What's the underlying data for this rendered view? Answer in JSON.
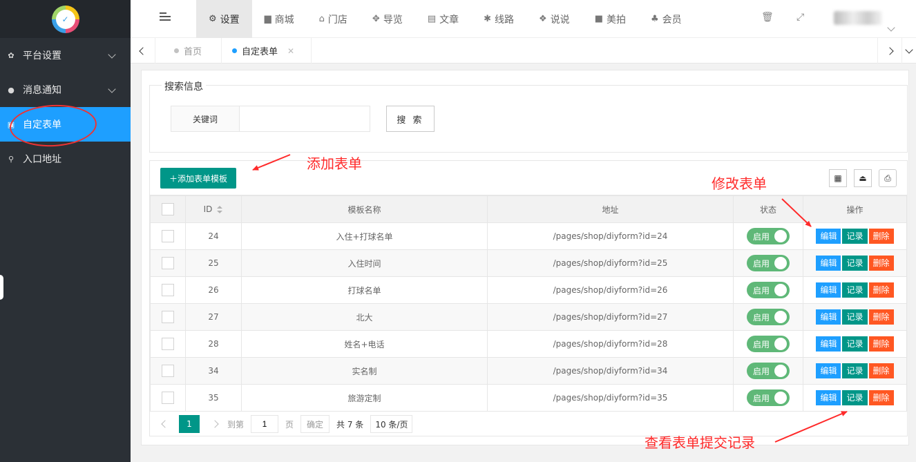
{
  "sidebar": {
    "logo_icon": "logo-badge",
    "logo_text": "✓",
    "items": [
      {
        "label": "平台设置",
        "icon": "gear-icon",
        "glyph": "✿",
        "has_chevron": true,
        "active": false
      },
      {
        "label": "消息通知",
        "icon": "chat-bubble-icon",
        "glyph": "●",
        "has_chevron": true,
        "active": false
      },
      {
        "label": "自定表单",
        "icon": "clipboard-icon",
        "glyph": "▣",
        "has_chevron": false,
        "active": true
      },
      {
        "label": "入口地址",
        "icon": "search-icon",
        "glyph": "⚲",
        "has_chevron": false,
        "active": false
      }
    ]
  },
  "header": {
    "menu_icon": "menu-fold-icon",
    "nav": [
      {
        "label": "设置",
        "glyph": "⚙",
        "icon": "gears-icon",
        "active": true
      },
      {
        "label": "商城",
        "glyph": "▆",
        "icon": "shopping-bag-icon",
        "active": false
      },
      {
        "label": "门店",
        "glyph": "⌂",
        "icon": "bank-icon",
        "active": false
      },
      {
        "label": "导览",
        "glyph": "✥",
        "icon": "cubes-icon",
        "active": false
      },
      {
        "label": "文章",
        "glyph": "▤",
        "icon": "newspaper-icon",
        "active": false
      },
      {
        "label": "线路",
        "glyph": "✱",
        "icon": "leaf-icon",
        "active": false
      },
      {
        "label": "说说",
        "glyph": "❖",
        "icon": "wechat-icon",
        "active": false
      },
      {
        "label": "美拍",
        "glyph": "■",
        "icon": "video-camera-icon",
        "active": false
      },
      {
        "label": "会员",
        "glyph": "♣",
        "icon": "users-icon",
        "active": false
      }
    ],
    "trash_glyph": "🗑",
    "fullscreen_glyph": "⤢"
  },
  "tabs": [
    {
      "label": "首页",
      "dot_color": "#c2c2c2",
      "active": false,
      "closable": false
    },
    {
      "label": "自定表单",
      "dot_color": "#1e9fff",
      "active": true,
      "closable": true
    }
  ],
  "search": {
    "legend": "搜索信息",
    "keyword_label": "关键词",
    "keyword_value": "",
    "button_label": "搜 索"
  },
  "toolbar": {
    "add_label": "＋添加表单模板",
    "tools": [
      {
        "icon": "columns-filter-icon",
        "glyph": "▦"
      },
      {
        "icon": "export-icon",
        "glyph": "⏏"
      },
      {
        "icon": "print-icon",
        "glyph": "⎙"
      }
    ]
  },
  "table": {
    "headers": {
      "id": "ID",
      "name": "模板名称",
      "address": "地址",
      "status": "状态",
      "ops": "操作"
    },
    "rows": [
      {
        "id": "24",
        "name": "入住+打球名单",
        "address": "/pages/shop/diyform?id=24",
        "status": "启用"
      },
      {
        "id": "25",
        "name": "入住时间",
        "address": "/pages/shop/diyform?id=25",
        "status": "启用"
      },
      {
        "id": "26",
        "name": "打球名单",
        "address": "/pages/shop/diyform?id=26",
        "status": "启用"
      },
      {
        "id": "27",
        "name": "北大",
        "address": "/pages/shop/diyform?id=27",
        "status": "启用"
      },
      {
        "id": "28",
        "name": "姓名+电话",
        "address": "/pages/shop/diyform?id=28",
        "status": "启用"
      },
      {
        "id": "34",
        "name": "实名制",
        "address": "/pages/shop/diyform?id=34",
        "status": "启用"
      },
      {
        "id": "35",
        "name": "旅游定制",
        "address": "/pages/shop/diyform?id=35",
        "status": "启用"
      }
    ],
    "op_labels": {
      "edit": "编辑",
      "record": "记录",
      "delete": "删除"
    }
  },
  "pager": {
    "current": "1",
    "goto_label": "到第",
    "goto_value": "1",
    "page_unit": "页",
    "confirm_label": "确定",
    "total_label": "共 7 条",
    "size_label": "10 条/页"
  },
  "annotations": {
    "add": "添加表单",
    "edit": "修改表单",
    "records": "查看表单提交记录"
  },
  "colors": {
    "sidebar_bg": "#2b3036",
    "active_blue": "#1e9fff",
    "teal": "#009688",
    "switch_green": "#5fb878",
    "danger": "#ff5722",
    "annotation_red": "#ff2a2a"
  }
}
